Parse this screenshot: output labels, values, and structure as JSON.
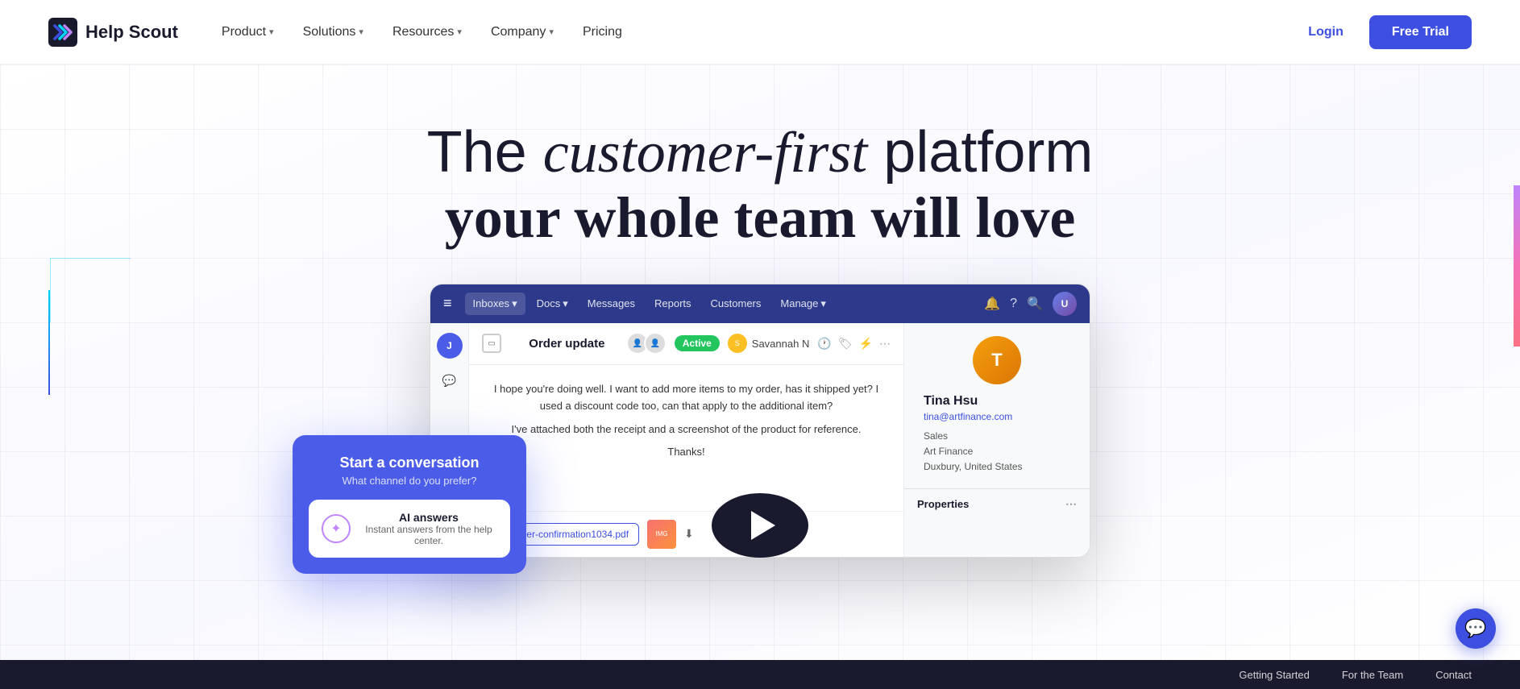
{
  "navbar": {
    "logo_text": "Help Scout",
    "nav_items": [
      {
        "label": "Product",
        "has_dropdown": true
      },
      {
        "label": "Solutions",
        "has_dropdown": true
      },
      {
        "label": "Resources",
        "has_dropdown": true
      },
      {
        "label": "Company",
        "has_dropdown": true
      },
      {
        "label": "Pricing",
        "has_dropdown": false
      }
    ],
    "login_label": "Login",
    "free_trial_label": "Free Trial"
  },
  "hero": {
    "line1_plain": "The ",
    "line1_italic": "customer-first",
    "line1_end": " platform",
    "line2": "your whole team will love"
  },
  "floating_card": {
    "title": "Start a conversation",
    "subtitle": "What channel do you prefer?",
    "ai_title": "AI answers",
    "ai_subtitle": "Instant answers from the help center."
  },
  "app": {
    "nav_items": [
      "Inboxes ▾",
      "Docs ▾",
      "Messages",
      "Reports",
      "Customers",
      "Manage ▾"
    ],
    "conversation": {
      "title": "Order update",
      "status": "Active",
      "assignee_name": "Savannah N",
      "message_p1": "I hope you're doing well. I want to add more items to my order, has it shipped yet? I used a discount code too, can that apply to the additional item?",
      "message_p2": "I've attached both the receipt and a screenshot of the product for reference.",
      "message_thanks": "Thanks!",
      "attachment_name": "order-confirmation1034.pdf"
    },
    "customer": {
      "name": "Tina Hsu",
      "email": "tina@artfinance.com",
      "department": "Sales",
      "company": "Art Finance",
      "location": "Duxbury, United States",
      "properties_label": "Properties"
    }
  },
  "bottom_bar": {
    "links": [
      "Getting Started",
      "For the Team",
      "Contact"
    ]
  },
  "chat_bubble": {
    "icon": "💬"
  }
}
